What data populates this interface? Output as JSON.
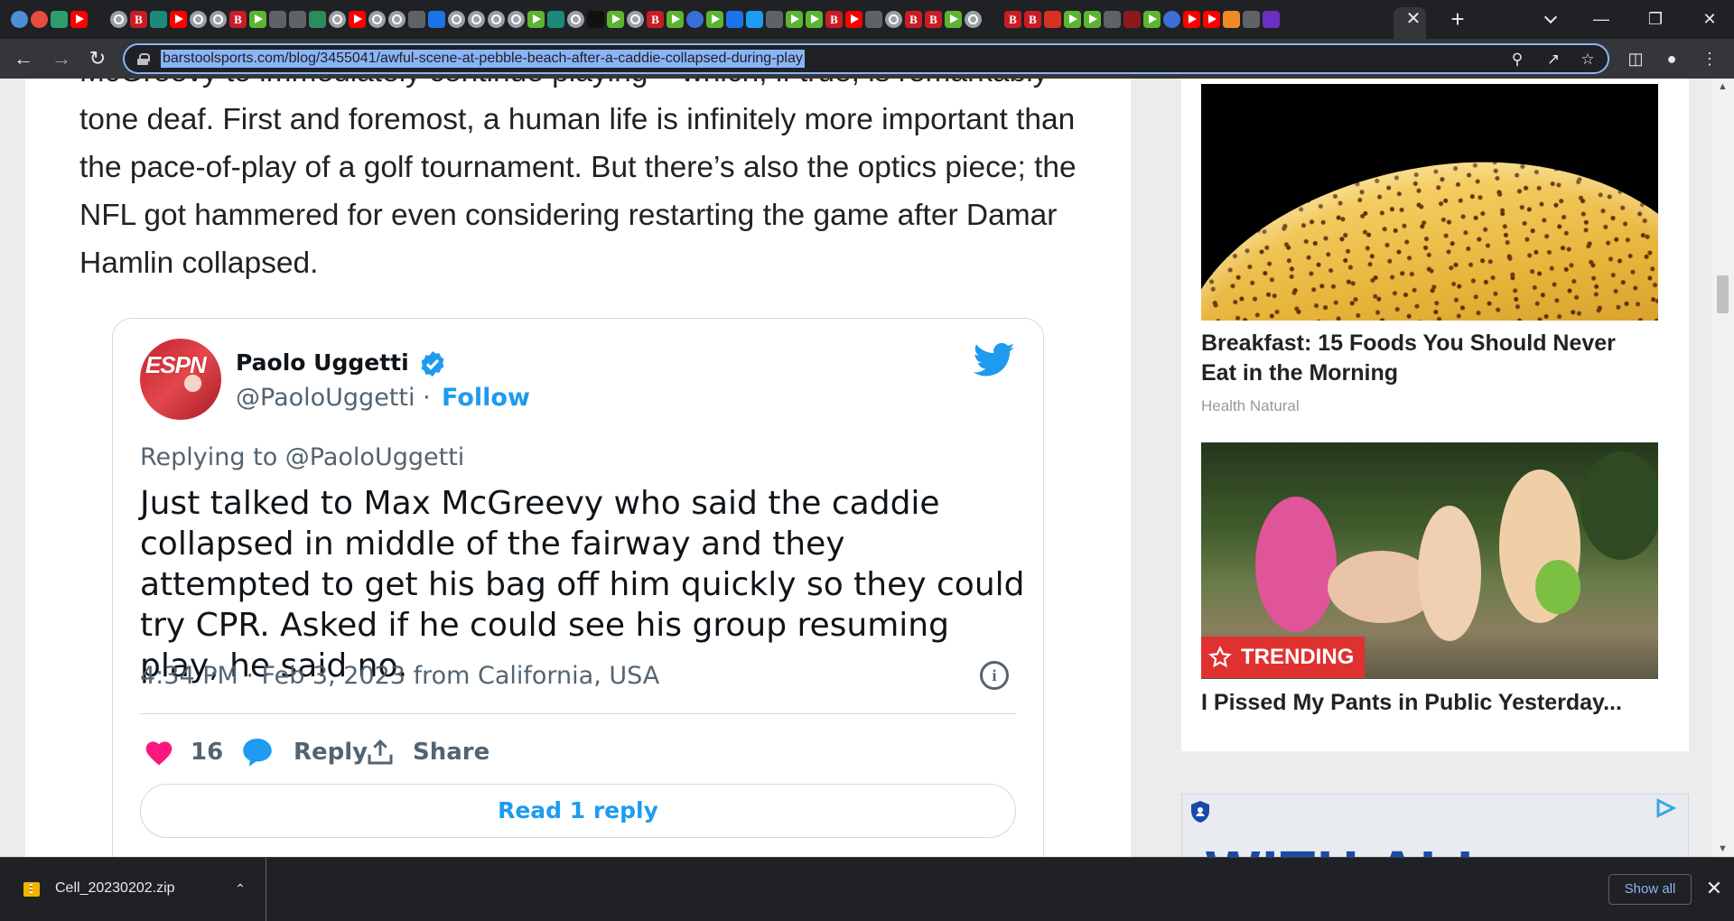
{
  "browser": {
    "url": "barstoolsports.com/blog/3455041/awful-scene-at-pebble-beach-after-a-caddie-collapsed-during-play",
    "tab_favicons": [
      {
        "icon": "globe-favicon",
        "color": "#4a90d9",
        "round": true
      },
      {
        "icon": "red-circle-favicon",
        "color": "#e84c3d",
        "round": true
      },
      {
        "icon": "green-stat-favicon",
        "color": "#2e9d6b"
      },
      {
        "icon": "youtube-favicon",
        "color": "#ff0000",
        "glyph": "play"
      },
      {
        "icon": "blank",
        "color": "#202124"
      },
      {
        "icon": "gray-circle-favicon",
        "color": "#9aa0a6",
        "glyph": "circ",
        "round": true
      },
      {
        "icon": "bi-favicon",
        "color": "#c81d25",
        "glyph": "bi"
      },
      {
        "icon": "teal-shield-favicon",
        "color": "#1c8a7a"
      },
      {
        "icon": "youtube-favicon",
        "color": "#ff0000",
        "glyph": "play"
      },
      {
        "icon": "gray-circle-favicon",
        "color": "#9aa0a6",
        "glyph": "circ",
        "round": true
      },
      {
        "icon": "gray-circle-favicon",
        "color": "#9aa0a6",
        "glyph": "circ",
        "round": true
      },
      {
        "icon": "bi-favicon",
        "color": "#c81d25",
        "glyph": "bi"
      },
      {
        "icon": "green-play-favicon",
        "color": "#5cb531",
        "glyph": "play"
      },
      {
        "icon": "gray-arrow-favicon",
        "color": "#5f6368"
      },
      {
        "icon": "blue-arrow-favicon",
        "color": "#5f6368"
      },
      {
        "icon": "x-favicon",
        "color": "#2c8c5a"
      },
      {
        "icon": "gray-circle-favicon",
        "color": "#9aa0a6",
        "glyph": "circ",
        "round": true
      },
      {
        "icon": "youtube-favicon",
        "color": "#ff0000",
        "glyph": "play"
      },
      {
        "icon": "gray-circle-favicon",
        "color": "#9aa0a6",
        "glyph": "circ",
        "round": true
      },
      {
        "icon": "gray-circle-favicon",
        "color": "#9aa0a6",
        "glyph": "circ",
        "round": true
      },
      {
        "icon": "gray-arrow-favicon",
        "color": "#5f6368"
      },
      {
        "icon": "search-favicon",
        "color": "#1a73e8"
      },
      {
        "icon": "gray-circle-favicon",
        "color": "#9aa0a6",
        "glyph": "circ",
        "round": true
      },
      {
        "icon": "gray-circle-favicon",
        "color": "#9aa0a6",
        "glyph": "circ",
        "round": true
      },
      {
        "icon": "gray-circle-favicon",
        "color": "#9aa0a6",
        "glyph": "circ",
        "round": true
      },
      {
        "icon": "gray-circle-favicon",
        "color": "#9aa0a6",
        "glyph": "circ",
        "round": true
      },
      {
        "icon": "green-play-favicon",
        "color": "#5cb531",
        "glyph": "play"
      },
      {
        "icon": "teal-shield-favicon",
        "color": "#1c8a7a"
      },
      {
        "icon": "gray-circle-favicon",
        "color": "#9aa0a6",
        "glyph": "circ",
        "round": true
      },
      {
        "icon": "n-favicon",
        "color": "#111111"
      },
      {
        "icon": "green-play-favicon",
        "color": "#5cb531",
        "glyph": "play"
      },
      {
        "icon": "gray-circle-favicon",
        "color": "#9aa0a6",
        "glyph": "circ",
        "round": true
      },
      {
        "icon": "bi-favicon",
        "color": "#c81d25",
        "glyph": "bi"
      },
      {
        "icon": "green-play-favicon",
        "color": "#5cb531",
        "glyph": "play"
      },
      {
        "icon": "blue-c-favicon",
        "color": "#3a6fd8",
        "round": true
      },
      {
        "icon": "green-play-favicon",
        "color": "#5cb531",
        "glyph": "play"
      },
      {
        "icon": "search-favicon",
        "color": "#1a73e8"
      },
      {
        "icon": "twitter-favicon",
        "color": "#1d9bf0"
      },
      {
        "icon": "gray-arrow-favicon",
        "color": "#5f6368"
      },
      {
        "icon": "green-play-favicon",
        "color": "#5cb531",
        "glyph": "play"
      },
      {
        "icon": "green-play-favicon",
        "color": "#5cb531",
        "glyph": "play"
      },
      {
        "icon": "bi-favicon",
        "color": "#c81d25",
        "glyph": "bi"
      },
      {
        "icon": "youtube-favicon",
        "color": "#ff0000",
        "glyph": "play"
      },
      {
        "icon": "uu-favicon",
        "color": "#5f6368"
      },
      {
        "icon": "gray-circle-favicon",
        "color": "#9aa0a6",
        "glyph": "circ",
        "round": true
      },
      {
        "icon": "bi-favicon",
        "color": "#c81d25",
        "glyph": "bi"
      },
      {
        "icon": "bi-favicon",
        "color": "#c81d25",
        "glyph": "bi"
      },
      {
        "icon": "green-play-favicon",
        "color": "#5cb531",
        "glyph": "play"
      },
      {
        "icon": "gray-circle-favicon",
        "color": "#9aa0a6",
        "glyph": "circ",
        "round": true
      },
      {
        "icon": "blank",
        "color": "#202124"
      },
      {
        "icon": "bi-favicon",
        "color": "#c81d25",
        "glyph": "bi"
      },
      {
        "icon": "bi-favicon",
        "color": "#c81d25",
        "glyph": "bi"
      },
      {
        "icon": "red-figure-favicon",
        "color": "#d93025"
      },
      {
        "icon": "green-play-favicon",
        "color": "#5cb531",
        "glyph": "play"
      },
      {
        "icon": "green-play-favicon",
        "color": "#5cb531",
        "glyph": "play"
      },
      {
        "icon": "gray-arrow-favicon",
        "color": "#5f6368"
      },
      {
        "icon": "bjc-favicon",
        "color": "#8b1a1a"
      },
      {
        "icon": "green-play-favicon",
        "color": "#5cb531",
        "glyph": "play"
      },
      {
        "icon": "blue-c-favicon",
        "color": "#3a6fd8",
        "round": true
      },
      {
        "icon": "youtube-favicon",
        "color": "#ff0000",
        "glyph": "play"
      },
      {
        "icon": "youtube-favicon",
        "color": "#ff0000",
        "glyph": "play"
      },
      {
        "icon": "orange-bookmark-favicon",
        "color": "#f08a24"
      },
      {
        "icon": "uu-favicon",
        "color": "#5f6368"
      },
      {
        "icon": "purple-mail-favicon",
        "color": "#6b2fc2"
      }
    ],
    "window_controls": {
      "minimize": "—",
      "maximize": "❐",
      "close": "✕"
    },
    "new_tab": "+",
    "active_tab_close": "✕"
  },
  "article": {
    "cut_line": "McGreevy to immediately continue playing – which, if true, is remarkably",
    "paragraph": "tone deaf. First and foremost, a human life is infinitely more important than the pace-of-play of a golf tournament. But there’s also the optics piece; the NFL got hammered for even considering restarting the game after Damar Hamlin collapsed."
  },
  "tweet": {
    "avatar_logo": "ESPN",
    "name": "Paolo Uggetti",
    "handle": "@PaoloUggetti",
    "separator": " · ",
    "follow": "Follow",
    "replying_to": "Replying to @PaoloUggetti",
    "body": "Just talked to Max McGreevy who said the caddie collapsed in middle of the fairway and they attempted to get his bag off him quickly so they could try CPR. Asked if he could see his group resuming play, he said no.",
    "meta": "4:34 PM · Feb 3, 2023 from California, USA",
    "likes": "16",
    "reply_label": "Reply",
    "share_label": "Share",
    "read_reply": "Read 1 reply",
    "colors": {
      "accent": "#1d9bf0",
      "like": "#f91880"
    }
  },
  "sidebar": {
    "article1": {
      "title": "Breakfast: 15 Foods You Should Never Eat in the Morning",
      "source": "Health Natural"
    },
    "trending_label": "TRENDING",
    "article2": {
      "title": "I Pissed My Pants in Public Yesterday..."
    },
    "ad_text": "WITH ALL"
  },
  "downloads": {
    "file_name": "Cell_20230202.zip",
    "show_all": "Show all"
  }
}
